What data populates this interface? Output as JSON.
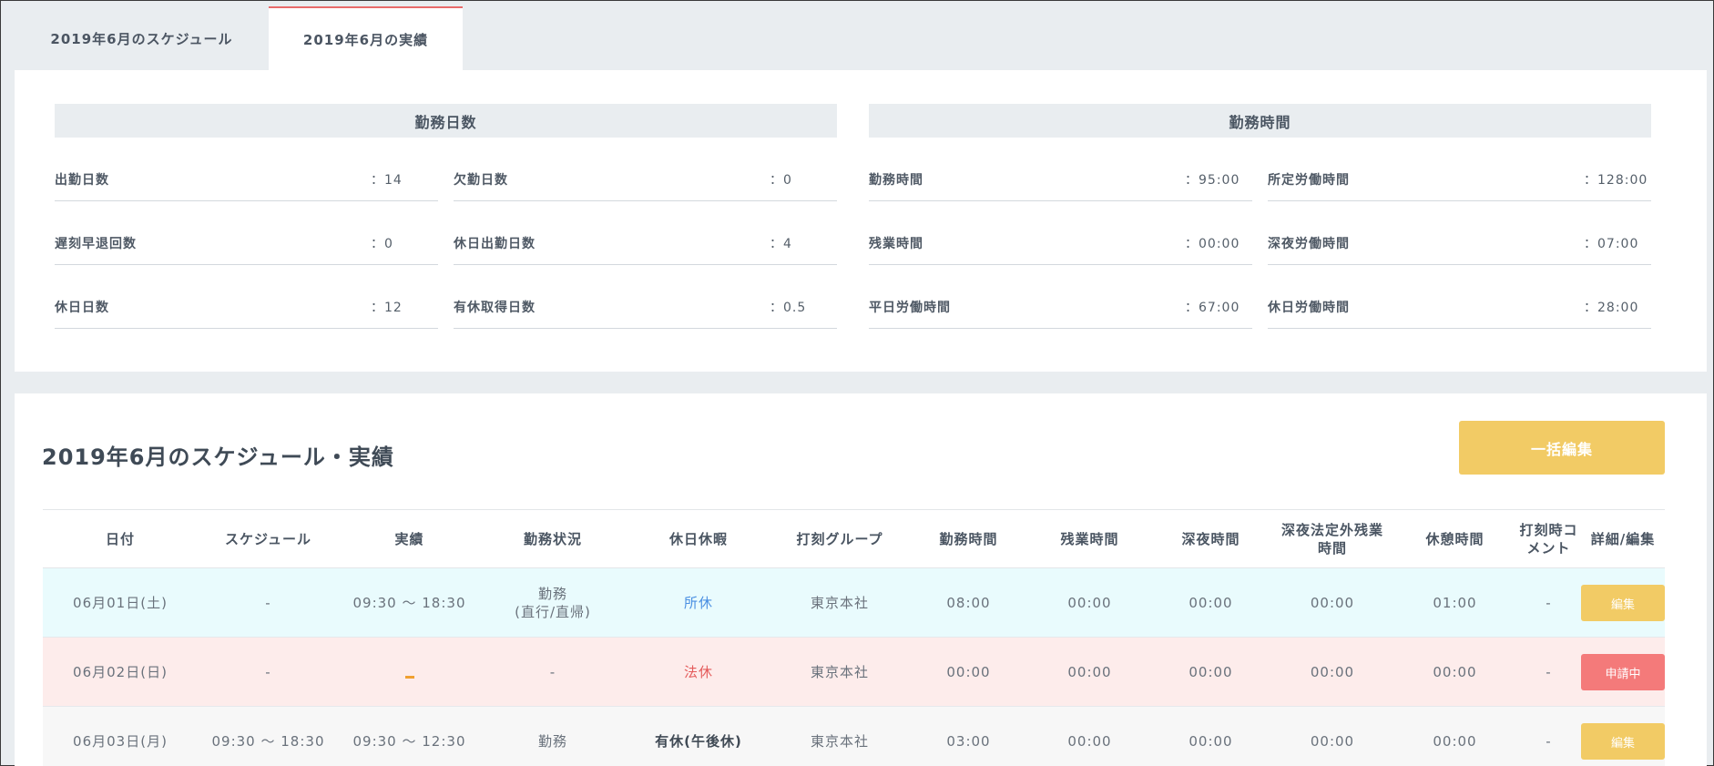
{
  "tabs": [
    {
      "label": "2019年6月のスケジュール"
    },
    {
      "label": "2019年6月の実績"
    }
  ],
  "summary": {
    "days": {
      "title": "勤務日数",
      "col1": [
        {
          "label": "出勤日数",
          "value": "：14"
        },
        {
          "label": "遅刻早退回数",
          "value": "：0"
        },
        {
          "label": "休日日数",
          "value": "：12"
        }
      ],
      "col2": [
        {
          "label": "欠勤日数",
          "value": "：0"
        },
        {
          "label": "休日出勤日数",
          "value": "：4"
        },
        {
          "label": "有休取得日数",
          "value": "：0.5"
        }
      ]
    },
    "hours": {
      "title": "勤務時間",
      "col1": [
        {
          "label": "勤務時間",
          "value": "：95:00"
        },
        {
          "label": "残業時間",
          "value": "：00:00"
        },
        {
          "label": "平日労働時間",
          "value": "：67:00"
        }
      ],
      "col2": [
        {
          "label": "所定労働時間",
          "value": "：128:00"
        },
        {
          "label": "深夜労働時間",
          "value": "：07:00"
        },
        {
          "label": "休日労働時間",
          "value": "：28:00"
        }
      ]
    }
  },
  "main": {
    "title": "2019年6月のスケジュール・実績",
    "bulk_edit_label": "一括編集"
  },
  "table": {
    "headers": {
      "date": "日付",
      "schedule": "スケジュール",
      "actual": "実績",
      "status": "勤務状況",
      "holiday": "休日休暇",
      "group": "打刻グループ",
      "work": "勤務時間",
      "overtime": "残業時間",
      "night": "深夜時間",
      "night_over_1": "深夜法定外残業",
      "night_over_2": "時間",
      "rest": "休憩時間",
      "comment_1": "打刻時コ",
      "comment_2": "メント",
      "edit": "詳細/編集"
    },
    "rows": [
      {
        "date": "06月01日(土)",
        "schedule": "-",
        "actual": "09:30 ～ 18:30",
        "status_1": "勤務",
        "status_2": "(直行/直帰)",
        "holiday": "所休",
        "group": "東京本社",
        "work": "08:00",
        "overtime": "00:00",
        "night": "00:00",
        "night_over": "00:00",
        "rest": "01:00",
        "comment": "-",
        "action": "編集"
      },
      {
        "date": "06月02日(日)",
        "schedule": "-",
        "status": "-",
        "holiday": "法休",
        "group": "東京本社",
        "work": "00:00",
        "overtime": "00:00",
        "night": "00:00",
        "night_over": "00:00",
        "rest": "00:00",
        "comment": "-",
        "action": "申請中"
      },
      {
        "date": "06月03日(月)",
        "schedule": "09:30 ～ 18:30",
        "actual": "09:30 ～ 12:30",
        "status": "勤務",
        "holiday": "有休(午後休)",
        "group": "東京本社",
        "work": "03:00",
        "overtime": "00:00",
        "night": "00:00",
        "night_over": "00:00",
        "rest": "00:00",
        "comment": "-",
        "action": "編集"
      }
    ]
  },
  "colors": {
    "accent_yellow": "#f2cb65",
    "pending_red": "#f47a7a",
    "tab_active_border": "#e86b6b",
    "row_weekday_bg": "#f7f7f7",
    "row_saturday_bg": "#e9fbfd",
    "row_sunday_bg": "#fdeceb"
  }
}
